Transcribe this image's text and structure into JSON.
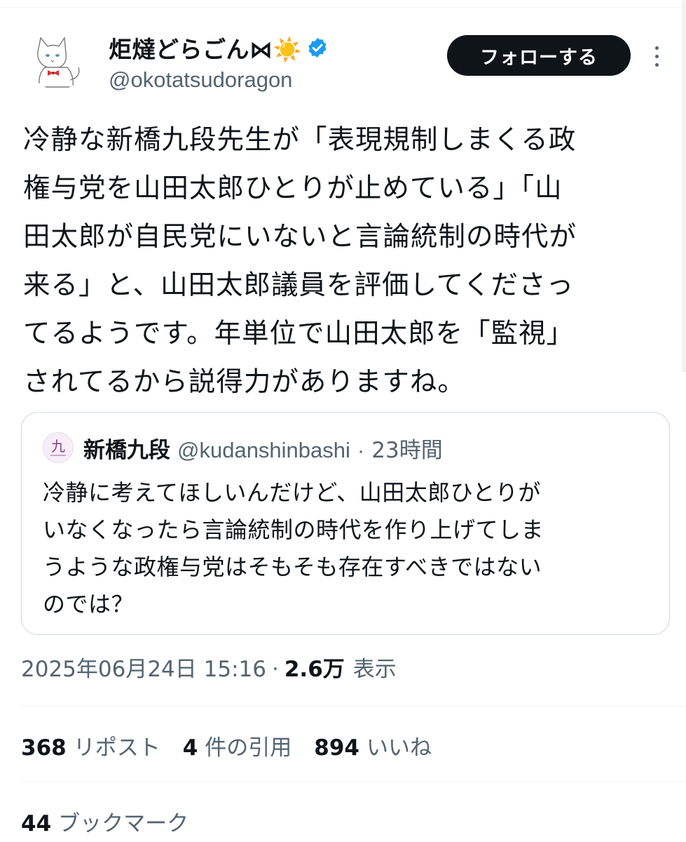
{
  "author": {
    "display_name": "炬燵どらごん⋈☀️",
    "handle": "@okotatsudoragon",
    "verified": true,
    "follow_label": "フォローする"
  },
  "tweet": {
    "lines": [
      "冷静な新橋九段先生が「表現規制しまくる政",
      "権与党を山田太郎ひとりが止めている」「山",
      "田太郎が自民党にいないと言論統制の時代が",
      "来る」と、山田太郎議員を評価してくださっ",
      "てるようです。年単位で山田太郎を「監視」",
      "されてるから説得力がありますね。"
    ]
  },
  "quoted_tweet": {
    "avatar_glyph": "九",
    "display_name": "新橋九段",
    "handle": "@kudanshinbashi",
    "separator": "·",
    "time": "23時間",
    "lines": [
      "冷静に考えてほしいんだけど、山田太郎ひとりが",
      "いなくなったら言論統制の時代を作り上げてしま",
      "うような政権与党はそもそも存在すべきではない",
      "のでは？"
    ]
  },
  "meta": {
    "timestamp": "2025年06月24日 15:16",
    "separator": "·",
    "views": "2.6万",
    "views_label": "表示"
  },
  "stats": {
    "reposts": "368",
    "reposts_label": "リポスト",
    "quotes": "4",
    "quotes_label": "件の引用",
    "likes": "894",
    "likes_label": "いいね",
    "bookmarks": "44",
    "bookmarks_label": "ブックマーク"
  },
  "colors": {
    "text": "#0f1419",
    "secondary": "#536471",
    "verified": "#1d9bf0",
    "border": "#cfd9de"
  }
}
